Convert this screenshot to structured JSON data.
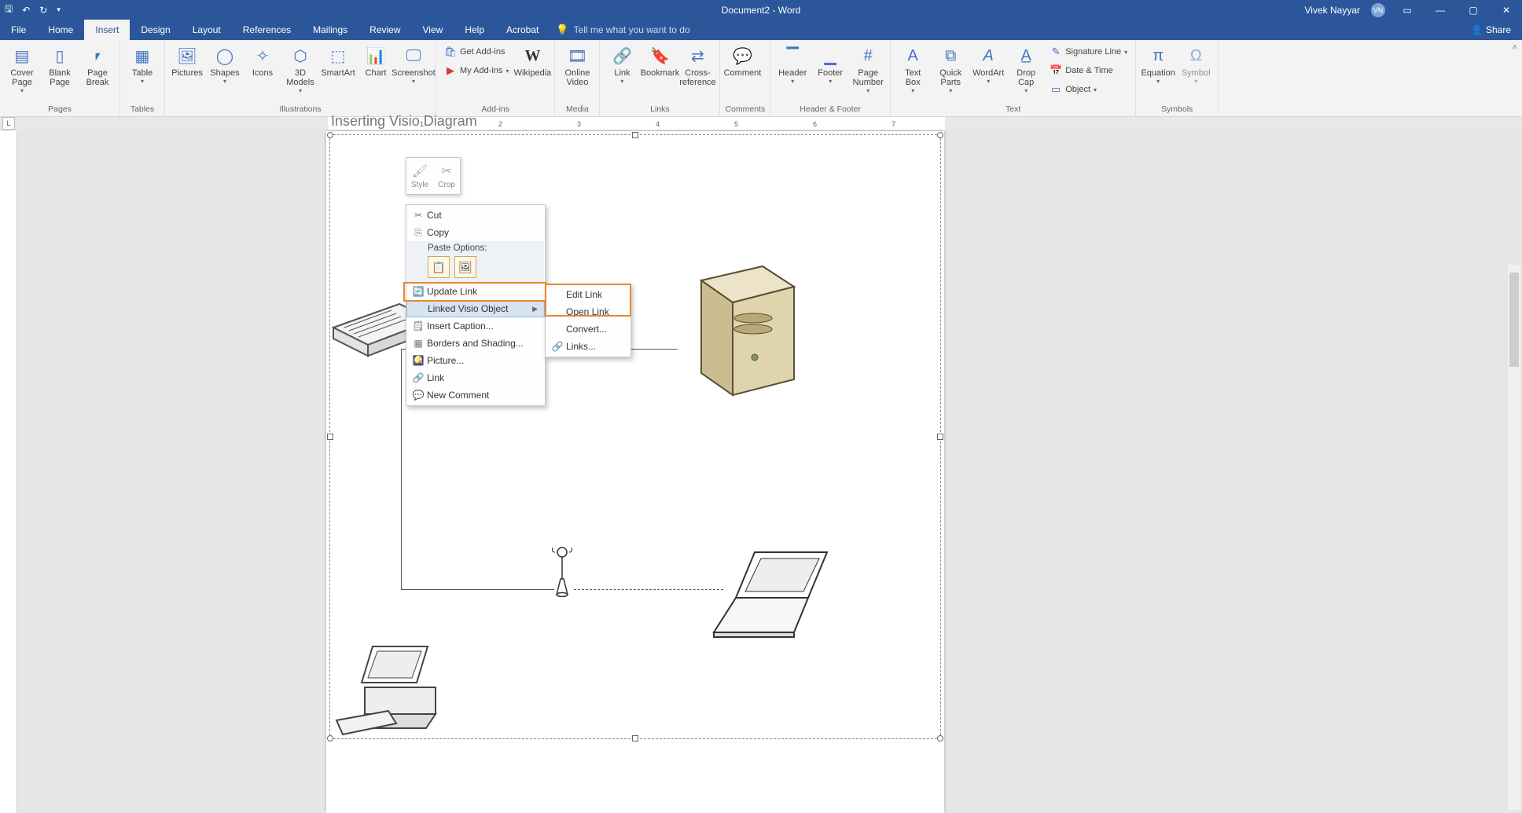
{
  "titlebar": {
    "doc_title": "Document2 - Word",
    "user_name": "Vivek Nayyar",
    "user_initials": "VN"
  },
  "tabs": {
    "file": "File",
    "home": "Home",
    "insert": "Insert",
    "design": "Design",
    "layout": "Layout",
    "references": "References",
    "mailings": "Mailings",
    "review": "Review",
    "view": "View",
    "help": "Help",
    "acrobat": "Acrobat",
    "tellme": "Tell me what you want to do",
    "share": "Share"
  },
  "ribbon": {
    "pages": {
      "label": "Pages",
      "cover": "Cover\nPage",
      "blank": "Blank\nPage",
      "break": "Page\nBreak"
    },
    "tables": {
      "label": "Tables",
      "table": "Table"
    },
    "illustrations": {
      "label": "Illustrations",
      "pictures": "Pictures",
      "shapes": "Shapes",
      "icons": "Icons",
      "models": "3D\nModels",
      "smartart": "SmartArt",
      "chart": "Chart",
      "screenshot": "Screenshot"
    },
    "addins": {
      "label": "Add-ins",
      "get": "Get Add-ins",
      "my": "My Add-ins",
      "wikipedia": "Wikipedia"
    },
    "media": {
      "label": "Media",
      "video": "Online\nVideo"
    },
    "links": {
      "label": "Links",
      "link": "Link",
      "bookmark": "Bookmark",
      "crossref": "Cross-\nreference"
    },
    "comments": {
      "label": "Comments",
      "comment": "Comment"
    },
    "headerfooter": {
      "label": "Header & Footer",
      "header": "Header",
      "footer": "Footer",
      "pagenum": "Page\nNumber"
    },
    "text": {
      "label": "Text",
      "textbox": "Text\nBox",
      "quickparts": "Quick\nParts",
      "wordart": "WordArt",
      "dropcap": "Drop\nCap",
      "sigline": "Signature Line",
      "datetime": "Date & Time",
      "object": "Object"
    },
    "symbols": {
      "label": "Symbols",
      "equation": "Equation",
      "symbol": "Symbol"
    }
  },
  "page": {
    "heading": "Inserting Visio Diagram"
  },
  "minibar": {
    "style": "Style",
    "crop": "Crop"
  },
  "context": {
    "cut": "Cut",
    "copy": "Copy",
    "paste_label": "Paste Options:",
    "update_link": "Update Link",
    "linked_object": "Linked Visio Object",
    "insert_caption": "Insert Caption...",
    "borders": "Borders and Shading...",
    "picture": "Picture...",
    "link": "Link",
    "new_comment": "New Comment"
  },
  "submenu": {
    "edit_link": "Edit  Link",
    "open_link": "Open  Link",
    "convert": "Convert...",
    "links": "Links..."
  },
  "ruler_ticks": [
    "1",
    "2",
    "3",
    "4",
    "5",
    "6",
    "7"
  ]
}
